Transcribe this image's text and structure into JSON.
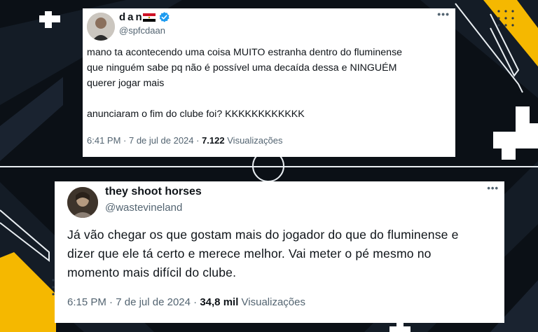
{
  "tweets": [
    {
      "name": "dan",
      "handle": "@spfcdaan",
      "verified": true,
      "text_lines": [
        "mano ta acontecendo uma coisa MUITO estranha dentro do fluminense",
        "que ninguém sabe pq não é possível uma decaída dessa e NINGUÉM",
        "querer jogar mais"
      ],
      "text_lines_2": [
        "anunciaram o fim do clube foi? KKKKKKKKKKKK"
      ],
      "time": "6:41 PM",
      "date": "7 de jul de 2024",
      "views_count": "7.122",
      "views_label": "Visualizações"
    },
    {
      "name": "they shoot horses",
      "handle": "@wastevineland",
      "verified": false,
      "text_lines": [
        "Já vão chegar os que gostam mais do jogador do que do fluminense e",
        "dizer que ele tá certo e merece melhor. Vai meter o pé mesmo no",
        "momento mais difícil do clube."
      ],
      "time": "6:15 PM",
      "date": "7 de jul de 2024",
      "views_count": "34,8 mil",
      "views_label": "Visualizações"
    }
  ],
  "icons": {
    "more": "more-options-icon",
    "verified": "verified-badge-icon",
    "flag": "egypt-flag-icon"
  },
  "colors": {
    "background": "#0b1016",
    "accent_yellow": "#f5b800",
    "card": "#ffffff",
    "text": "#0f1419",
    "secondary_text": "#536471",
    "verified_blue": "#1d9bf0"
  }
}
